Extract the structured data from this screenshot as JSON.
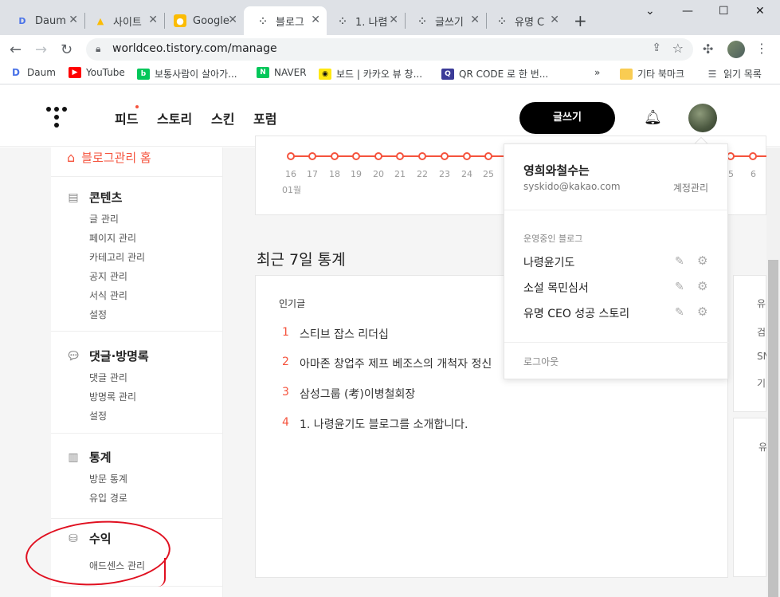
{
  "browser": {
    "tabs": [
      {
        "title": "Daum",
        "favicon": "daum-favicon",
        "color": "#4a73e8"
      },
      {
        "title": "사이트",
        "favicon": "google-ads-favicon",
        "color": "#fbbc04"
      },
      {
        "title": "Google",
        "favicon": "google-favicon",
        "color": "#fbbc04"
      },
      {
        "title": "블로그",
        "favicon": "tistory-favicon",
        "color": "#111111"
      },
      {
        "title": "1. 나렴",
        "favicon": "tistory-favicon",
        "color": "#111111"
      },
      {
        "title": "글쓰기",
        "favicon": "tistory-favicon",
        "color": "#111111"
      },
      {
        "title": "유명 C",
        "favicon": "tistory-favicon",
        "color": "#111111"
      }
    ],
    "url": "worldceo.tistory.com/manage",
    "bookmarks": [
      {
        "label": "Daum",
        "icon": "daum-icon",
        "color": "#4a73e8"
      },
      {
        "label": "YouTube",
        "icon": "youtube-icon",
        "color": "#ff0000"
      },
      {
        "label": "보통사람이 살아가...",
        "icon": "blog-icon",
        "color": "#03c75a"
      },
      {
        "label": "NAVER",
        "icon": "naver-icon",
        "color": "#03c75a"
      },
      {
        "label": "보드 | 카카오 뷰 창...",
        "icon": "kakao-view-icon",
        "color": "#ffe812"
      },
      {
        "label": "QR CODE 로 한 번...",
        "icon": "qr-icon",
        "color": "#3b3b98"
      },
      {
        "label": "기타 북마크",
        "icon": "folder-icon",
        "color": "#f9cc52"
      },
      {
        "label": "읽기 목록",
        "icon": "reading-list-icon",
        "color": "#5f6368"
      }
    ],
    "overflow": "»"
  },
  "header": {
    "nav": [
      "피드",
      "스토리",
      "스킨",
      "포럼"
    ],
    "write_button": "글쓰기"
  },
  "sidebar": {
    "home": "블로그관리 홈",
    "sections": [
      {
        "title": "콘텐츠",
        "icon": "document-icon",
        "items": [
          "글 관리",
          "페이지 관리",
          "카테고리 관리",
          "공지 관리",
          "서식 관리",
          "설정"
        ]
      },
      {
        "title": "댓글·방명록",
        "icon": "speech-bubble-icon",
        "items": [
          "댓글 관리",
          "방명록 관리",
          "설정"
        ]
      },
      {
        "title": "통계",
        "icon": "bar-chart-icon",
        "items": [
          "방문 통계",
          "유입 경로"
        ]
      },
      {
        "title": "수익",
        "icon": "coins-icon",
        "items": [
          "애드센스 관리"
        ]
      }
    ]
  },
  "chart": {
    "x_ticks": [
      "16",
      "17",
      "18",
      "19",
      "20",
      "21",
      "22",
      "23",
      "24",
      "25",
      "5",
      "6"
    ],
    "month_label": "01월"
  },
  "main": {
    "section_title": "최근 7일 통계",
    "popular_label": "인기글",
    "popular": [
      {
        "rank": "1",
        "title": "스티브 잡스 리더십"
      },
      {
        "rank": "2",
        "title": "아마존 창업주 제프 베조스의 개척자 정신"
      },
      {
        "rank": "3",
        "title": "삼성그룹 (考)이병철회장"
      },
      {
        "rank": "4",
        "title": "1. 나령윤기도 블로그를 소개합니다."
      }
    ],
    "right_col_texts": [
      "유",
      "검",
      "SN",
      "기",
      "유"
    ]
  },
  "dropdown": {
    "name": "영희와철수는",
    "email": "syskido@kakao.com",
    "account": "계정관리",
    "blogs_label": "운영중인 블로그",
    "blogs": [
      "나령윤기도",
      "소설 목민심서",
      "유명 CEO 성공 스토리"
    ],
    "logout": "로그아웃"
  }
}
